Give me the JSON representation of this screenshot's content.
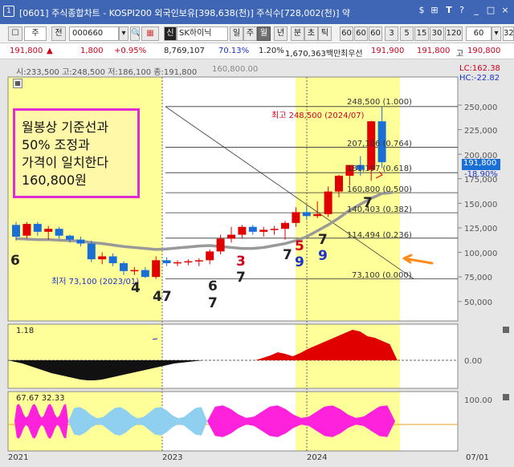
{
  "window": {
    "icon_label": "1",
    "title": "[0601] 주식종합차트 - KOSPI200 외국인보유[398,638(천)] 주식수[728,002(천)] 약",
    "controls": [
      "$",
      "⊞",
      "?",
      "_",
      "□",
      "×"
    ]
  },
  "toolbar": {
    "nav_prev": "◀",
    "market": "주",
    "jeon": "전",
    "code": "000660",
    "sin": "신",
    "stock_name": "SK하이닉",
    "periods": [
      "일",
      "주",
      "월",
      "년",
      "분",
      "초",
      "틱"
    ],
    "selected_period": "월",
    "intervals": [
      "60",
      "60",
      "60",
      "3",
      "5",
      "15",
      "30",
      "120",
      "60"
    ],
    "last": "32"
  },
  "infobar": {
    "price": "191,800",
    "arrow": "▲",
    "change": "1,800",
    "change_pct": "+0.95%",
    "volume": "8,769,107",
    "ratio": "70.13%",
    "turnover": "1.20%",
    "amount": "1,670,363백만",
    "hoga_label": "최우선",
    "ask": "191,900",
    "bid": "191,800",
    "high_label": "고",
    "high": "190,800"
  },
  "chart_data": {
    "type": "candlestick",
    "ohlc_label": "시:233,500 고:248,500 저:186,100 종:191,800",
    "ohlc_extra": "160,800.00",
    "lc_label": "LC:162.38",
    "hc_label": "HC:-22.82",
    "current_price": "191,800",
    "current_pct": "-18.90%",
    "y_ticks": [
      "250,000",
      "225,000",
      "200,000",
      "175,000",
      "150,000",
      "125,000",
      "100,000",
      "75,000",
      "50,000"
    ],
    "high_annotation": "최고 248,500 (2024/07)",
    "low_annotation": "최저 73,100 (2023/01)",
    "fib_levels": [
      {
        "label": "248,500 (1.000)",
        "value": 248500
      },
      {
        "label": "207,106 (0.764)",
        "value": 207106
      },
      {
        "label": "181,197 (0.618)",
        "value": 181197
      },
      {
        "label": "160,800 (0.500)",
        "value": 160800
      },
      {
        "label": "140,403 (0.382)",
        "value": 140403
      },
      {
        "label": "114,494 (0.236)",
        "value": 114494
      },
      {
        "label": "73,100 (0.000)",
        "value": 73100
      }
    ],
    "candles": [
      [
        128000,
        131000,
        112000,
        116000
      ],
      [
        117000,
        131000,
        114000,
        129000
      ],
      [
        129000,
        131000,
        117000,
        121000
      ],
      [
        121000,
        127000,
        113000,
        124000
      ],
      [
        124000,
        126000,
        114000,
        117000
      ],
      [
        117000,
        118000,
        110000,
        113000
      ],
      [
        113000,
        116000,
        106000,
        109000
      ],
      [
        109000,
        112000,
        90000,
        93000
      ],
      [
        93000,
        100000,
        88000,
        96000
      ],
      [
        96000,
        99000,
        86000,
        89000
      ],
      [
        89000,
        91000,
        77000,
        81000
      ],
      [
        81000,
        85000,
        77000,
        82000
      ],
      [
        82000,
        85000,
        74000,
        75000
      ],
      [
        75000,
        96000,
        73100,
        92000
      ],
      [
        92000,
        95000,
        86000,
        89000
      ],
      [
        89000,
        92000,
        86000,
        90000
      ],
      [
        90000,
        93000,
        87000,
        91000
      ],
      [
        91000,
        94000,
        86000,
        92000
      ],
      [
        92000,
        103000,
        88000,
        101000
      ],
      [
        101000,
        118000,
        98000,
        114000
      ],
      [
        114000,
        126000,
        110000,
        118000
      ],
      [
        118000,
        128000,
        114000,
        126000
      ],
      [
        126000,
        128000,
        118000,
        121000
      ],
      [
        121000,
        126000,
        116000,
        123000
      ],
      [
        123000,
        127000,
        118000,
        124000
      ],
      [
        124000,
        132000,
        113000,
        130000
      ],
      [
        130000,
        146000,
        126000,
        141000
      ],
      [
        141000,
        147000,
        133000,
        137000
      ],
      [
        137000,
        152000,
        135000,
        139000
      ],
      [
        139000,
        167000,
        136000,
        162000
      ],
      [
        162000,
        179000,
        156000,
        178000
      ],
      [
        178000,
        189000,
        168000,
        189000
      ],
      [
        189000,
        198000,
        178000,
        184000
      ],
      [
        184000,
        234000,
        173000,
        233500
      ],
      [
        233500,
        248500,
        186100,
        191800
      ]
    ],
    "signal_line": [
      114000,
      113500,
      113000,
      113000,
      112500,
      112000,
      111500,
      110000,
      109000,
      107500,
      106000,
      105000,
      104000,
      103000,
      103500,
      104500,
      105500,
      106500,
      107000,
      106000,
      105000,
      104000,
      104000,
      105000,
      107000,
      109000,
      112000,
      116000,
      122000,
      128000,
      135000,
      143000,
      149000,
      155000,
      160000,
      161000
    ],
    "count_labels": [
      {
        "t": "6",
        "c": "black"
      },
      {
        "t": "4",
        "c": "black"
      },
      {
        "t": "47",
        "c": "black"
      },
      {
        "t": "6",
        "c": "black"
      },
      {
        "t": "7",
        "c": "black"
      },
      {
        "t": "3",
        "c": "red"
      },
      {
        "t": "7",
        "c": "black"
      },
      {
        "t": "7",
        "c": "black"
      },
      {
        "t": "5",
        "c": "red"
      },
      {
        "t": "9",
        "c": "blue"
      },
      {
        "t": "7",
        "c": "black"
      },
      {
        "t": "9",
        "c": "blue"
      },
      {
        "t": "7",
        "c": "black"
      }
    ],
    "osc1": {
      "label": "1.18",
      "ylabel": "0.00"
    },
    "osc2": {
      "label": "67.67 32.33",
      "ylabel": "100.00"
    },
    "x_labels": [
      "2021",
      "2023",
      "2024",
      "07/01"
    ]
  },
  "annotation_box": {
    "line1": "월봉상 기준선과",
    "line2": "50% 조정과",
    "line3": "가격이 일치한다",
    "line4": "160,800원"
  },
  "colors": {
    "up": "#e00000",
    "down": "#1a6fd6",
    "yellow": "#ffff9a",
    "magenta": "#ff22dd",
    "lightblue": "#8fcff0",
    "gray_line": "#999999",
    "arrow": "#ff8c1a"
  }
}
